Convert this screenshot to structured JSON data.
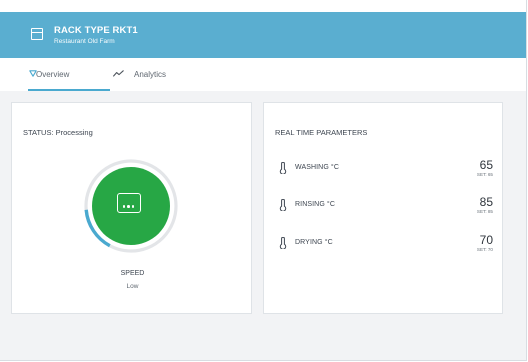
{
  "header": {
    "title": "RACK TYPE  RKT1",
    "subtitle": "Restaurant Old Farm",
    "icon": "window-icon"
  },
  "tabs": [
    {
      "label": "Overview",
      "icon": "triangle-down-icon",
      "active": true
    },
    {
      "label": "Analytics",
      "icon": "trend-line-icon",
      "active": false
    }
  ],
  "status_card": {
    "title": "STATUS: Processing",
    "gauge_icon": "dishwasher-icon",
    "gauge_color": "#27a745",
    "gauge_progress_color": "#4aa9cf",
    "speed_label": "SPEED",
    "speed_value": "Low"
  },
  "params_card": {
    "title": "REAL TIME PARAMETERS",
    "set_prefix": "SET",
    "items": [
      {
        "name": "WASHING °C",
        "value": "65",
        "set": "65",
        "icon": "thermometer-icon"
      },
      {
        "name": "RINSING °C",
        "value": "85",
        "set": "85",
        "icon": "thermometer-icon"
      },
      {
        "name": "DRYING °C",
        "value": "70",
        "set": "70",
        "icon": "thermometer-icon"
      }
    ]
  }
}
